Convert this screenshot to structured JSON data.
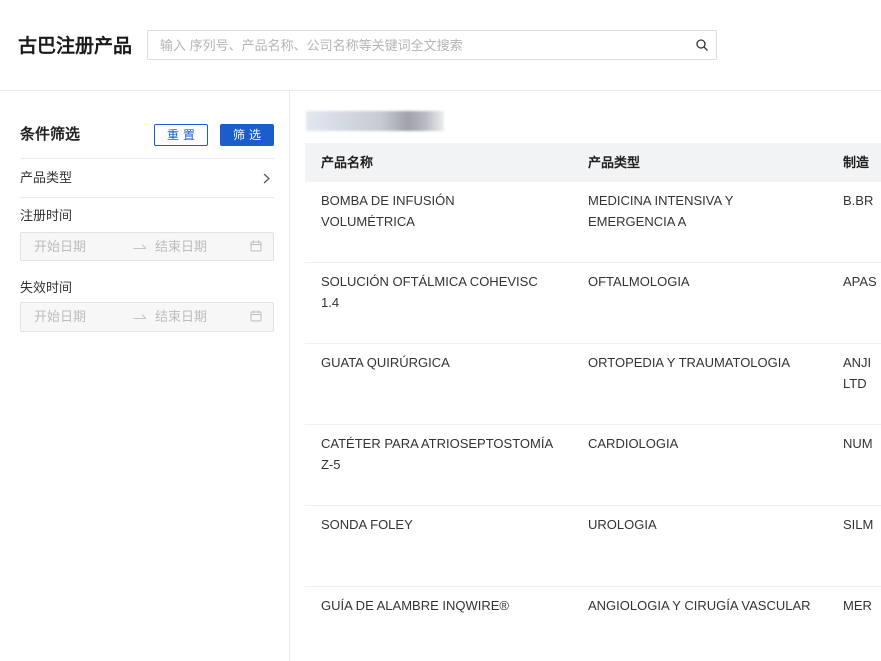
{
  "header": {
    "title": "古巴注册产品",
    "search": {
      "placeholder": "输入 序列号、产品名称、公司名称等关键词全文搜索",
      "value": "",
      "icon": "search-icon"
    }
  },
  "sidebar": {
    "title": "条件筛选",
    "reset_button": "重置",
    "filter_button": "筛选",
    "product_type": {
      "label": "产品类型",
      "icon": "chevron-right-icon"
    },
    "registration_date": {
      "label": "注册时间",
      "start_placeholder": "开始日期",
      "end_placeholder": "结束日期",
      "separator_icon": "arrow-right-icon",
      "icon": "calendar-icon"
    },
    "expiry_date": {
      "label": "失效时间",
      "start_placeholder": "开始日期",
      "end_placeholder": "结束日期",
      "separator_icon": "arrow-right-icon",
      "icon": "calendar-icon"
    }
  },
  "table": {
    "columns": [
      "产品名称",
      "产品类型",
      "制造"
    ],
    "rows": [
      {
        "name": "BOMBA DE INFUSIÓN\nVOLUMÉTRICA",
        "type": "MEDICINA INTENSIVA Y\nEMERGENCIA A",
        "manufacturer": "B.BR"
      },
      {
        "name": "SOLUCIÓN OFTÁLMICA COHEVISC\n1.4",
        "type": "OFTALMOLOGIA",
        "manufacturer": "APAS"
      },
      {
        "name": "GUATA QUIRÚRGICA",
        "type": "ORTOPEDIA Y TRAUMATOLOGIA",
        "manufacturer": "ANJI\nLTD"
      },
      {
        "name": "CATÉTER PARA ATRIOSEPTOSTOMÍA\nZ-5",
        "type": "CARDIOLOGIA",
        "manufacturer": "NUM"
      },
      {
        "name": "SONDA FOLEY",
        "type": "UROLOGIA",
        "manufacturer": "SILM"
      },
      {
        "name": "GUÍA DE ALAMBRE INQWIRE®",
        "type": "ANGIOLOGIA Y CIRUGÍA VASCULAR",
        "manufacturer": "MER"
      }
    ]
  },
  "colors": {
    "accent": "#1a5dcb",
    "table_header_bg": "#f2f3f5",
    "border": "#ebebeb",
    "placeholder": "#bdbdbd"
  }
}
